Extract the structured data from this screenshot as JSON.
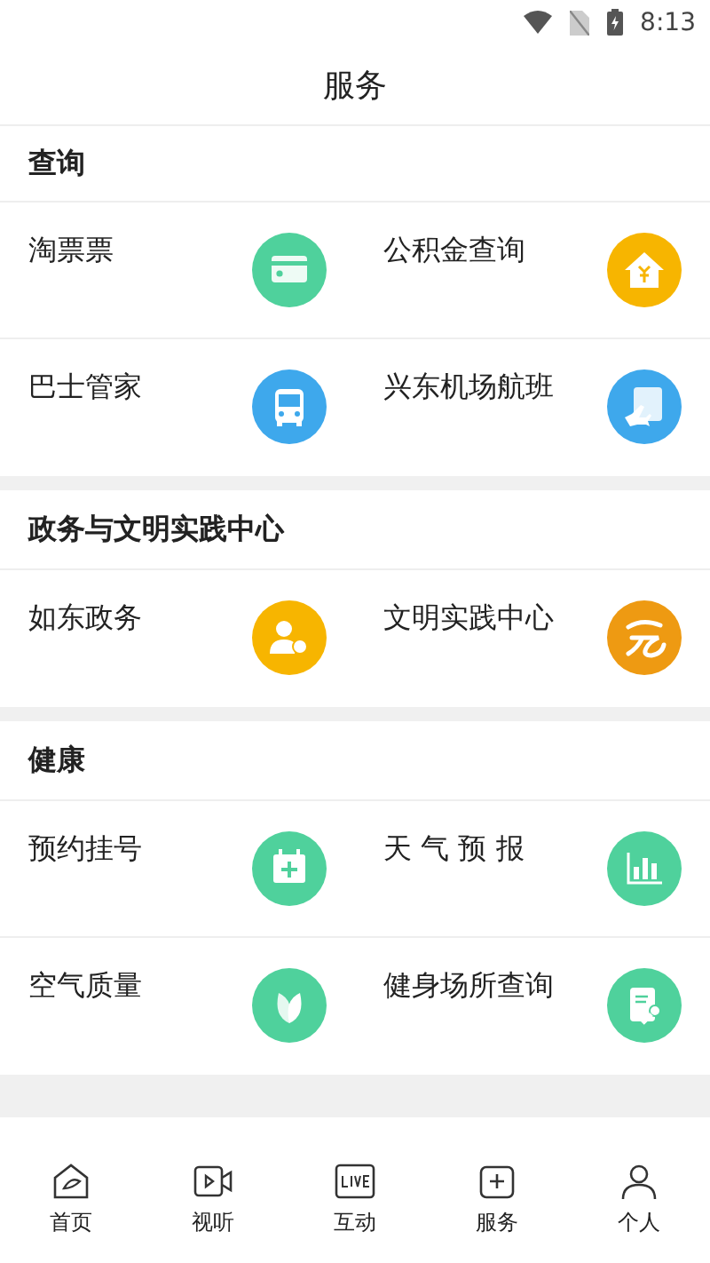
{
  "status_bar": {
    "time": "8:13"
  },
  "header": {
    "title": "服务"
  },
  "sections": [
    {
      "title": "查询",
      "items": [
        {
          "label": "淘票票",
          "kind": "card",
          "color": "#4fd19c"
        },
        {
          "label": "公积金查询",
          "kind": "house",
          "color": "#f7b500"
        },
        {
          "label": "巴士管家",
          "kind": "bus",
          "color": "#3ea8ec"
        },
        {
          "label": "兴东机场航班",
          "kind": "plane",
          "color": "#3ea8ec"
        }
      ]
    },
    {
      "title": "政务与文明实践中心",
      "items": [
        {
          "label": "如东政务",
          "kind": "person",
          "color": "#f7b500"
        },
        {
          "label": "文明实践中心",
          "kind": "swirl",
          "color": "#ee9a12"
        }
      ]
    },
    {
      "title": "健康",
      "items": [
        {
          "label": "预约挂号",
          "kind": "calendar",
          "color": "#4fd19c"
        },
        {
          "label": "天 气 预 报",
          "kind": "chart",
          "color": "#4fd19c"
        },
        {
          "label": "空气质量",
          "kind": "leaf",
          "color": "#4fd19c"
        },
        {
          "label": "健身场所查询",
          "kind": "doc",
          "color": "#4fd19c"
        }
      ]
    }
  ],
  "nav": [
    {
      "label": "首页",
      "kind": "home"
    },
    {
      "label": "视听",
      "kind": "video"
    },
    {
      "label": "互动",
      "kind": "live"
    },
    {
      "label": "服务",
      "kind": "service"
    },
    {
      "label": "个人",
      "kind": "person"
    }
  ]
}
